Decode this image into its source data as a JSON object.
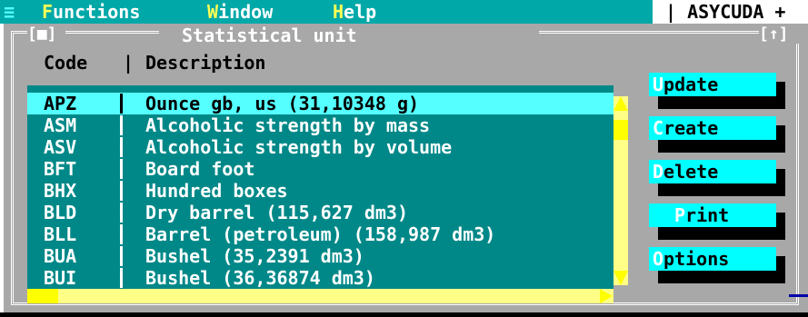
{
  "menubar": {
    "system_icon": "≡",
    "items": [
      {
        "hot": "F",
        "rest": "unctions"
      },
      {
        "hot": "W",
        "rest": "indow"
      },
      {
        "hot": "H",
        "rest": "elp"
      }
    ],
    "app_title": "| ASYCUDA +"
  },
  "window": {
    "title": "Statistical unit",
    "close_icon": "[■]",
    "zoom_icon": "[↑]"
  },
  "list": {
    "header_code": "Code",
    "header_sep": "|",
    "header_desc": "Description",
    "selected_index": 0,
    "rows": [
      {
        "code": "APZ",
        "desc": "Ounce gb, us (31,10348 g)"
      },
      {
        "code": "ASM",
        "desc": "Alcoholic strength by mass"
      },
      {
        "code": "ASV",
        "desc": "Alcoholic strength by volume"
      },
      {
        "code": "BFT",
        "desc": "Board foot"
      },
      {
        "code": "BHX",
        "desc": "Hundred boxes"
      },
      {
        "code": "BLD",
        "desc": "Dry barrel (115,627 dm3)"
      },
      {
        "code": "BLL",
        "desc": "Barrel (petroleum) (158,987 dm3)"
      },
      {
        "code": "BUA",
        "desc": "Bushel (35,2391 dm3)"
      },
      {
        "code": "BUI",
        "desc": "Bushel (36,36874 dm3)"
      }
    ]
  },
  "buttons": {
    "update": {
      "hot": "U",
      "rest": "pdate"
    },
    "create": {
      "hot": "C",
      "rest": "reate"
    },
    "delete": {
      "hot": "D",
      "rest": "elete"
    },
    "print": {
      "hot": "P",
      "rest": "rint"
    },
    "options": {
      "hot": "O",
      "rest": "ptions"
    }
  },
  "colors": {
    "menubar": "#00a8a8",
    "window_bg": "#a8a8a8",
    "list_bg": "#008888",
    "selection": "#55ffff",
    "button": "#00ffff",
    "scrollbar": "#ffff88",
    "hotkey_menu": "#ffff55"
  }
}
